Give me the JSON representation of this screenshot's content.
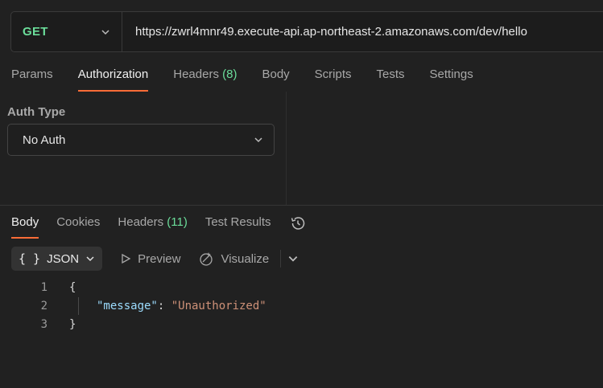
{
  "request": {
    "method": "GET",
    "url": "https://zwrl4mnr49.execute-api.ap-northeast-2.amazonaws.com/dev/hello"
  },
  "request_tabs": {
    "params": "Params",
    "authorization": "Authorization",
    "headers": "Headers",
    "headers_count": "(8)",
    "body": "Body",
    "scripts": "Scripts",
    "tests": "Tests",
    "settings": "Settings"
  },
  "auth": {
    "label": "Auth Type",
    "value": "No Auth"
  },
  "response_tabs": {
    "body": "Body",
    "cookies": "Cookies",
    "headers": "Headers",
    "headers_count": "(11)",
    "test_results": "Test Results"
  },
  "response_toolbar": {
    "format_braces": "{ }",
    "format": "JSON",
    "preview": "Preview",
    "visualize": "Visualize"
  },
  "code": {
    "lines": [
      {
        "num": "1",
        "text": "{"
      },
      {
        "num": "2",
        "key": "\"message\"",
        "colon": ": ",
        "value": "\"Unauthorized\""
      },
      {
        "num": "3",
        "text": "}"
      }
    ]
  },
  "colors": {
    "accent": "#ff6c37",
    "method_get": "#6bdd9a",
    "json_key": "#9cdcfe",
    "json_string": "#ce9178"
  },
  "icons": [
    "chevron-down-icon",
    "history-icon",
    "play-icon",
    "visualize-icon"
  ]
}
